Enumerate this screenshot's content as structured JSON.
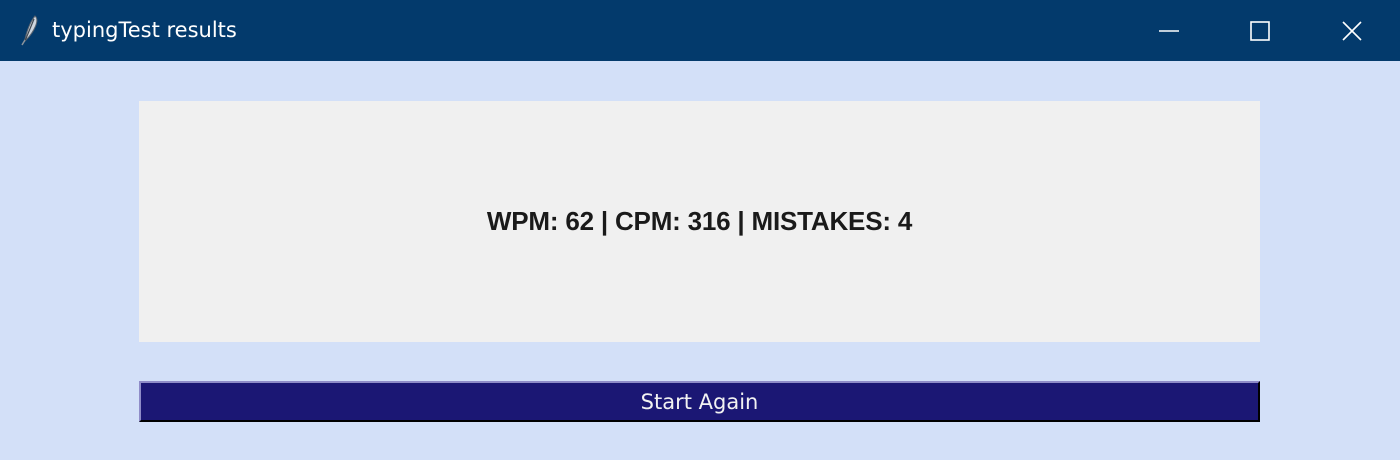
{
  "window": {
    "title": "typingTest results",
    "app_icon": "feather-icon",
    "controls": {
      "minimize_icon": "minimize-icon",
      "maximize_icon": "maximize-icon",
      "close_icon": "close-icon"
    }
  },
  "results": {
    "summary": "WPM: 62 | CPM: 316 | MISTAKES: 4"
  },
  "actions": {
    "start_again_label": "Start Again"
  },
  "colors": {
    "titlebar": "#033a6c",
    "window_background": "#d3e0f8",
    "panel_background": "#f0f0f0",
    "button_background": "#1b1774",
    "button_text": "#f2f2f2"
  }
}
